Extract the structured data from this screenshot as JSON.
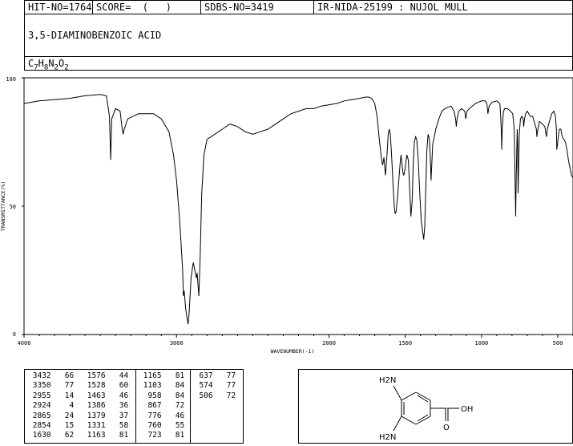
{
  "header": {
    "hit_no": "HIT-NO=1764",
    "score": "SCORE=  (   )",
    "sdbs_no": "SDBS-NO=3419",
    "ir_nida": "IR-NIDA-25199 : NUJOL MULL"
  },
  "compound": {
    "name": "3,5-DIAMINOBENZOIC ACID",
    "formula_parts": [
      {
        "t": "C",
        "sub": "7"
      },
      {
        "t": "H",
        "sub": "8"
      },
      {
        "t": "N",
        "sub": "2"
      },
      {
        "t": "O",
        "sub": "2"
      }
    ]
  },
  "chart_data": {
    "type": "line",
    "xlabel": "WAVENUMBER(-1)",
    "ylabel": "TRANSMITTANCE(%)",
    "xlim": [
      4000,
      400
    ],
    "ylim": [
      0,
      100
    ],
    "x_ticks": [
      4000,
      3000,
      2000,
      1500,
      1000,
      500
    ],
    "y_ticks": [
      0,
      50,
      100
    ],
    "grid": false,
    "series": [
      {
        "points": [
          [
            4000,
            90
          ],
          [
            3900,
            91
          ],
          [
            3800,
            91.5
          ],
          [
            3700,
            92
          ],
          [
            3600,
            93
          ],
          [
            3500,
            93.5
          ],
          [
            3460,
            93
          ],
          [
            3440,
            85
          ],
          [
            3432,
            68
          ],
          [
            3425,
            84
          ],
          [
            3400,
            88
          ],
          [
            3370,
            87
          ],
          [
            3356,
            80
          ],
          [
            3350,
            78
          ],
          [
            3343,
            80
          ],
          [
            3320,
            84
          ],
          [
            3250,
            86
          ],
          [
            3150,
            86
          ],
          [
            3100,
            84
          ],
          [
            3050,
            79
          ],
          [
            3020,
            70
          ],
          [
            3000,
            60
          ],
          [
            2980,
            45
          ],
          [
            2960,
            25
          ],
          [
            2955,
            15
          ],
          [
            2950,
            17
          ],
          [
            2940,
            10
          ],
          [
            2930,
            6
          ],
          [
            2924,
            4
          ],
          [
            2918,
            8
          ],
          [
            2905,
            22
          ],
          [
            2898,
            25
          ],
          [
            2890,
            28
          ],
          [
            2880,
            25
          ],
          [
            2870,
            22
          ],
          [
            2865,
            24
          ],
          [
            2860,
            20
          ],
          [
            2854,
            15
          ],
          [
            2846,
            28
          ],
          [
            2835,
            55
          ],
          [
            2820,
            70
          ],
          [
            2800,
            76
          ],
          [
            2750,
            78
          ],
          [
            2700,
            80
          ],
          [
            2650,
            82
          ],
          [
            2600,
            81
          ],
          [
            2550,
            79
          ],
          [
            2500,
            78
          ],
          [
            2450,
            79
          ],
          [
            2400,
            80
          ],
          [
            2350,
            82
          ],
          [
            2300,
            84
          ],
          [
            2250,
            86
          ],
          [
            2200,
            87
          ],
          [
            2150,
            88
          ],
          [
            2100,
            88
          ],
          [
            2050,
            89
          ],
          [
            2000,
            89.5
          ],
          [
            1950,
            90
          ],
          [
            1900,
            91
          ],
          [
            1850,
            91.5
          ],
          [
            1800,
            92
          ],
          [
            1760,
            92.5
          ],
          [
            1740,
            92.5
          ],
          [
            1720,
            92
          ],
          [
            1700,
            90
          ],
          [
            1685,
            85
          ],
          [
            1670,
            76
          ],
          [
            1655,
            68
          ],
          [
            1648,
            66
          ],
          [
            1640,
            69
          ],
          [
            1630,
            62
          ],
          [
            1620,
            70
          ],
          [
            1612,
            78
          ],
          [
            1605,
            80
          ],
          [
            1598,
            78
          ],
          [
            1590,
            70
          ],
          [
            1580,
            58
          ],
          [
            1572,
            50
          ],
          [
            1566,
            47
          ],
          [
            1560,
            48
          ],
          [
            1550,
            54
          ],
          [
            1540,
            62
          ],
          [
            1533,
            67
          ],
          [
            1528,
            70
          ],
          [
            1522,
            67
          ],
          [
            1515,
            63
          ],
          [
            1510,
            62
          ],
          [
            1500,
            65
          ],
          [
            1490,
            70
          ],
          [
            1480,
            68
          ],
          [
            1472,
            58
          ],
          [
            1463,
            46
          ],
          [
            1455,
            52
          ],
          [
            1448,
            66
          ],
          [
            1440,
            75
          ],
          [
            1432,
            77
          ],
          [
            1425,
            76
          ],
          [
            1415,
            68
          ],
          [
            1405,
            55
          ],
          [
            1395,
            44
          ],
          [
            1386,
            40
          ],
          [
            1379,
            37
          ],
          [
            1372,
            42
          ],
          [
            1365,
            58
          ],
          [
            1358,
            72
          ],
          [
            1350,
            78
          ],
          [
            1342,
            76
          ],
          [
            1335,
            68
          ],
          [
            1331,
            60
          ],
          [
            1327,
            65
          ],
          [
            1320,
            74
          ],
          [
            1300,
            80
          ],
          [
            1280,
            84
          ],
          [
            1260,
            87
          ],
          [
            1240,
            88
          ],
          [
            1220,
            88.5
          ],
          [
            1200,
            89
          ],
          [
            1180,
            87
          ],
          [
            1170,
            84
          ],
          [
            1165,
            81
          ],
          [
            1160,
            84
          ],
          [
            1150,
            87
          ],
          [
            1130,
            88
          ],
          [
            1110,
            87
          ],
          [
            1103,
            84
          ],
          [
            1095,
            87
          ],
          [
            1080,
            88
          ],
          [
            1060,
            89
          ],
          [
            1040,
            90
          ],
          [
            1020,
            90.5
          ],
          [
            1000,
            91
          ],
          [
            975,
            91
          ],
          [
            965,
            90
          ],
          [
            958,
            86
          ],
          [
            950,
            89
          ],
          [
            930,
            90.5
          ],
          [
            900,
            91
          ],
          [
            880,
            90
          ],
          [
            875,
            86
          ],
          [
            870,
            79
          ],
          [
            867,
            72
          ],
          [
            864,
            80
          ],
          [
            858,
            86
          ],
          [
            850,
            88
          ],
          [
            830,
            88
          ],
          [
            810,
            87
          ],
          [
            795,
            86
          ],
          [
            785,
            80
          ],
          [
            780,
            60
          ],
          [
            776,
            46
          ],
          [
            772,
            62
          ],
          [
            766,
            80
          ],
          [
            763,
            75
          ],
          [
            760,
            55
          ],
          [
            757,
            65
          ],
          [
            752,
            78
          ],
          [
            745,
            84
          ],
          [
            735,
            85
          ],
          [
            727,
            84
          ],
          [
            723,
            81
          ],
          [
            718,
            84
          ],
          [
            710,
            86
          ],
          [
            700,
            87
          ],
          [
            690,
            86
          ],
          [
            680,
            85
          ],
          [
            665,
            85
          ],
          [
            650,
            82
          ],
          [
            640,
            80
          ],
          [
            637,
            77
          ],
          [
            630,
            80
          ],
          [
            620,
            83
          ],
          [
            600,
            82
          ],
          [
            585,
            81
          ],
          [
            574,
            77
          ],
          [
            568,
            80
          ],
          [
            555,
            83
          ],
          [
            540,
            86
          ],
          [
            525,
            87
          ],
          [
            515,
            85
          ],
          [
            509,
            80
          ],
          [
            506,
            72
          ],
          [
            500,
            75
          ],
          [
            490,
            80
          ],
          [
            480,
            80
          ],
          [
            470,
            77
          ],
          [
            460,
            76
          ],
          [
            450,
            75
          ],
          [
            440,
            72
          ],
          [
            430,
            68
          ],
          [
            420,
            65
          ],
          [
            410,
            62
          ],
          [
            400,
            61
          ]
        ]
      }
    ]
  },
  "peak_table": {
    "columns": [
      [
        [
          "3432",
          "66"
        ],
        [
          "3350",
          "77"
        ],
        [
          "2955",
          "14"
        ],
        [
          "2924",
          "4"
        ],
        [
          "2865",
          "24"
        ],
        [
          "2854",
          "15"
        ],
        [
          "1630",
          "62"
        ]
      ],
      [
        [
          "1576",
          "44"
        ],
        [
          "1528",
          "60"
        ],
        [
          "1463",
          "46"
        ],
        [
          "1386",
          "36"
        ],
        [
          "1379",
          "37"
        ],
        [
          "1331",
          "58"
        ],
        [
          "1163",
          "81"
        ]
      ],
      [
        [
          "1165",
          "81"
        ],
        [
          "1103",
          "84"
        ],
        [
          "958",
          "84"
        ],
        [
          "867",
          "72"
        ],
        [
          "776",
          "46"
        ],
        [
          "760",
          "55"
        ],
        [
          "723",
          "81"
        ]
      ],
      [
        [
          "637",
          "77"
        ],
        [
          "574",
          "77"
        ],
        [
          "506",
          "72"
        ]
      ]
    ]
  },
  "structure": {
    "label_top": "H2N",
    "label_bottom": "H2N",
    "label_oh": "OH",
    "label_o": "O"
  }
}
